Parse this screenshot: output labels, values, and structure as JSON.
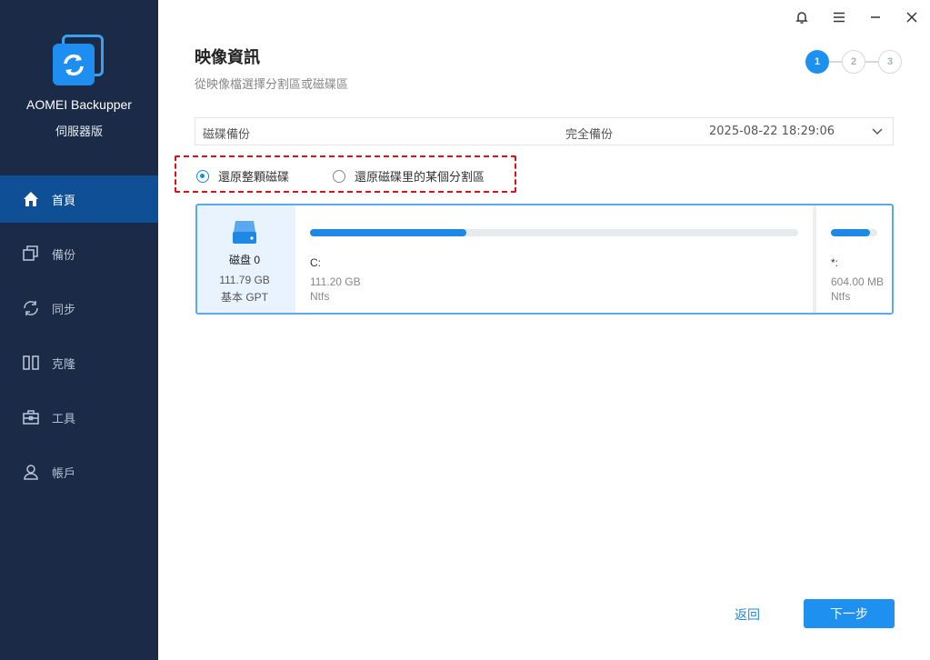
{
  "app": {
    "name": "AOMEI Backupper",
    "edition": "伺服器版"
  },
  "colors": {
    "sidebar_bg": "#1b2a47",
    "sidebar_active": "#0e4f96",
    "accent": "#1e90f0",
    "highlight_border": "#e0101a"
  },
  "sidebar": {
    "items": [
      {
        "label": "首頁",
        "icon": "home-icon",
        "active": true
      },
      {
        "label": "備份",
        "icon": "backup-icon",
        "active": false
      },
      {
        "label": "同步",
        "icon": "sync-icon",
        "active": false
      },
      {
        "label": "克隆",
        "icon": "clone-icon",
        "active": false
      },
      {
        "label": "工具",
        "icon": "toolbox-icon",
        "active": false
      },
      {
        "label": "帳戶",
        "icon": "user-icon",
        "active": false
      }
    ]
  },
  "window_controls": [
    "bell-icon",
    "menu-icon",
    "minimize-icon",
    "close-icon"
  ],
  "page": {
    "title": "映像資訊",
    "subtitle": "從映像檔選擇分割區或磁碟區"
  },
  "steps": [
    "1",
    "2",
    "3"
  ],
  "current_step": 1,
  "image_selector": {
    "type": "磁碟備份",
    "mode": "完全備份",
    "timestamp": "2025-08-22 18:29:06"
  },
  "restore_options": [
    {
      "label": "還原整顆磁碟",
      "checked": true
    },
    {
      "label": "還原磁碟里的某個分割區",
      "checked": false
    }
  ],
  "disk": {
    "name": "磁盘 0",
    "size": "111.79 GB",
    "type": "基本 GPT",
    "partitions": [
      {
        "letter": "C:",
        "size": "111.20 GB",
        "fs": "Ntfs",
        "used_fraction": 0.32
      },
      {
        "letter": "*:",
        "size": "604.00 MB",
        "fs": "Ntfs",
        "used_fraction": 0.85
      }
    ]
  },
  "buttons": {
    "back": "返回",
    "next": "下一步"
  }
}
